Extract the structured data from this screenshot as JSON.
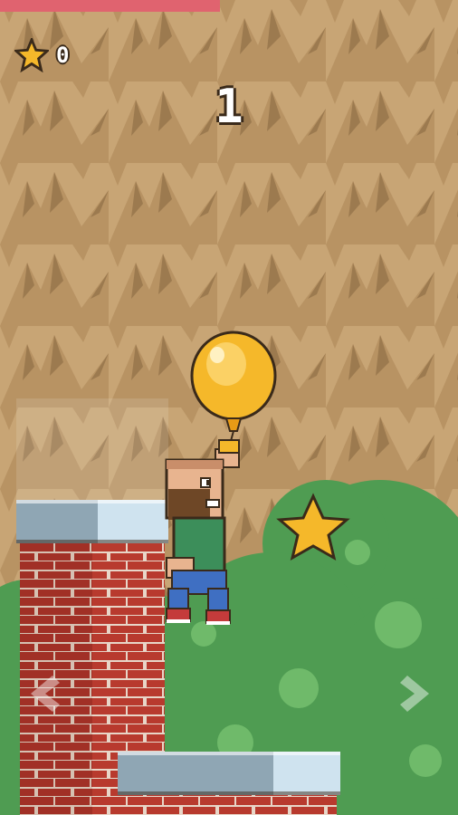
{
  "hud": {
    "stars_collected": "0",
    "score": "1",
    "level_progress": 0.48,
    "star_icon": "star-icon"
  },
  "controls": {
    "left_icon": "chevron-left-icon",
    "right_icon": "chevron-right-icon"
  },
  "colors": {
    "sky_rock": "#c8a575",
    "rock_dark": "#9c7a4f",
    "brick": "#b83a2e",
    "brick_mortar": "#e8d6c8",
    "cap_light": "#cfe3ef",
    "cap_dark": "#8fa6b4",
    "foliage": "#4f9c52",
    "foliage_light": "#6fba6a",
    "balloon": "#f5b82a",
    "star": "#f5b82a",
    "progress_bar": "#e0636f"
  },
  "entities": {
    "player": "bearded-man-player",
    "balloon": "balloon",
    "pickup": "star-pickup"
  }
}
